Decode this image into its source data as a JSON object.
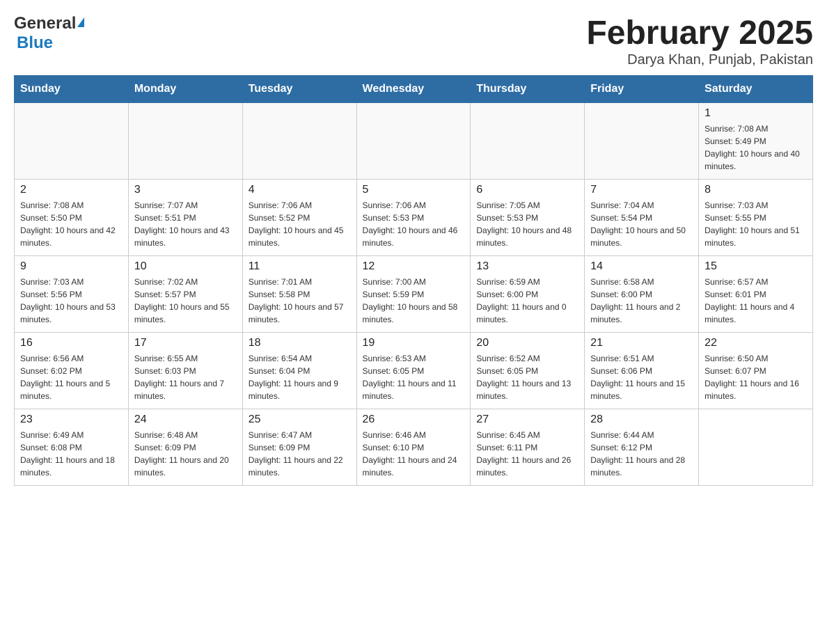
{
  "header": {
    "logo_general": "General",
    "logo_blue": "Blue",
    "title": "February 2025",
    "subtitle": "Darya Khan, Punjab, Pakistan"
  },
  "days_of_week": [
    "Sunday",
    "Monday",
    "Tuesday",
    "Wednesday",
    "Thursday",
    "Friday",
    "Saturday"
  ],
  "weeks": [
    {
      "days": [
        {
          "number": "",
          "sunrise": "",
          "sunset": "",
          "daylight": ""
        },
        {
          "number": "",
          "sunrise": "",
          "sunset": "",
          "daylight": ""
        },
        {
          "number": "",
          "sunrise": "",
          "sunset": "",
          "daylight": ""
        },
        {
          "number": "",
          "sunrise": "",
          "sunset": "",
          "daylight": ""
        },
        {
          "number": "",
          "sunrise": "",
          "sunset": "",
          "daylight": ""
        },
        {
          "number": "",
          "sunrise": "",
          "sunset": "",
          "daylight": ""
        },
        {
          "number": "1",
          "sunrise": "Sunrise: 7:08 AM",
          "sunset": "Sunset: 5:49 PM",
          "daylight": "Daylight: 10 hours and 40 minutes."
        }
      ]
    },
    {
      "days": [
        {
          "number": "2",
          "sunrise": "Sunrise: 7:08 AM",
          "sunset": "Sunset: 5:50 PM",
          "daylight": "Daylight: 10 hours and 42 minutes."
        },
        {
          "number": "3",
          "sunrise": "Sunrise: 7:07 AM",
          "sunset": "Sunset: 5:51 PM",
          "daylight": "Daylight: 10 hours and 43 minutes."
        },
        {
          "number": "4",
          "sunrise": "Sunrise: 7:06 AM",
          "sunset": "Sunset: 5:52 PM",
          "daylight": "Daylight: 10 hours and 45 minutes."
        },
        {
          "number": "5",
          "sunrise": "Sunrise: 7:06 AM",
          "sunset": "Sunset: 5:53 PM",
          "daylight": "Daylight: 10 hours and 46 minutes."
        },
        {
          "number": "6",
          "sunrise": "Sunrise: 7:05 AM",
          "sunset": "Sunset: 5:53 PM",
          "daylight": "Daylight: 10 hours and 48 minutes."
        },
        {
          "number": "7",
          "sunrise": "Sunrise: 7:04 AM",
          "sunset": "Sunset: 5:54 PM",
          "daylight": "Daylight: 10 hours and 50 minutes."
        },
        {
          "number": "8",
          "sunrise": "Sunrise: 7:03 AM",
          "sunset": "Sunset: 5:55 PM",
          "daylight": "Daylight: 10 hours and 51 minutes."
        }
      ]
    },
    {
      "days": [
        {
          "number": "9",
          "sunrise": "Sunrise: 7:03 AM",
          "sunset": "Sunset: 5:56 PM",
          "daylight": "Daylight: 10 hours and 53 minutes."
        },
        {
          "number": "10",
          "sunrise": "Sunrise: 7:02 AM",
          "sunset": "Sunset: 5:57 PM",
          "daylight": "Daylight: 10 hours and 55 minutes."
        },
        {
          "number": "11",
          "sunrise": "Sunrise: 7:01 AM",
          "sunset": "Sunset: 5:58 PM",
          "daylight": "Daylight: 10 hours and 57 minutes."
        },
        {
          "number": "12",
          "sunrise": "Sunrise: 7:00 AM",
          "sunset": "Sunset: 5:59 PM",
          "daylight": "Daylight: 10 hours and 58 minutes."
        },
        {
          "number": "13",
          "sunrise": "Sunrise: 6:59 AM",
          "sunset": "Sunset: 6:00 PM",
          "daylight": "Daylight: 11 hours and 0 minutes."
        },
        {
          "number": "14",
          "sunrise": "Sunrise: 6:58 AM",
          "sunset": "Sunset: 6:00 PM",
          "daylight": "Daylight: 11 hours and 2 minutes."
        },
        {
          "number": "15",
          "sunrise": "Sunrise: 6:57 AM",
          "sunset": "Sunset: 6:01 PM",
          "daylight": "Daylight: 11 hours and 4 minutes."
        }
      ]
    },
    {
      "days": [
        {
          "number": "16",
          "sunrise": "Sunrise: 6:56 AM",
          "sunset": "Sunset: 6:02 PM",
          "daylight": "Daylight: 11 hours and 5 minutes."
        },
        {
          "number": "17",
          "sunrise": "Sunrise: 6:55 AM",
          "sunset": "Sunset: 6:03 PM",
          "daylight": "Daylight: 11 hours and 7 minutes."
        },
        {
          "number": "18",
          "sunrise": "Sunrise: 6:54 AM",
          "sunset": "Sunset: 6:04 PM",
          "daylight": "Daylight: 11 hours and 9 minutes."
        },
        {
          "number": "19",
          "sunrise": "Sunrise: 6:53 AM",
          "sunset": "Sunset: 6:05 PM",
          "daylight": "Daylight: 11 hours and 11 minutes."
        },
        {
          "number": "20",
          "sunrise": "Sunrise: 6:52 AM",
          "sunset": "Sunset: 6:05 PM",
          "daylight": "Daylight: 11 hours and 13 minutes."
        },
        {
          "number": "21",
          "sunrise": "Sunrise: 6:51 AM",
          "sunset": "Sunset: 6:06 PM",
          "daylight": "Daylight: 11 hours and 15 minutes."
        },
        {
          "number": "22",
          "sunrise": "Sunrise: 6:50 AM",
          "sunset": "Sunset: 6:07 PM",
          "daylight": "Daylight: 11 hours and 16 minutes."
        }
      ]
    },
    {
      "days": [
        {
          "number": "23",
          "sunrise": "Sunrise: 6:49 AM",
          "sunset": "Sunset: 6:08 PM",
          "daylight": "Daylight: 11 hours and 18 minutes."
        },
        {
          "number": "24",
          "sunrise": "Sunrise: 6:48 AM",
          "sunset": "Sunset: 6:09 PM",
          "daylight": "Daylight: 11 hours and 20 minutes."
        },
        {
          "number": "25",
          "sunrise": "Sunrise: 6:47 AM",
          "sunset": "Sunset: 6:09 PM",
          "daylight": "Daylight: 11 hours and 22 minutes."
        },
        {
          "number": "26",
          "sunrise": "Sunrise: 6:46 AM",
          "sunset": "Sunset: 6:10 PM",
          "daylight": "Daylight: 11 hours and 24 minutes."
        },
        {
          "number": "27",
          "sunrise": "Sunrise: 6:45 AM",
          "sunset": "Sunset: 6:11 PM",
          "daylight": "Daylight: 11 hours and 26 minutes."
        },
        {
          "number": "28",
          "sunrise": "Sunrise: 6:44 AM",
          "sunset": "Sunset: 6:12 PM",
          "daylight": "Daylight: 11 hours and 28 minutes."
        },
        {
          "number": "",
          "sunrise": "",
          "sunset": "",
          "daylight": ""
        }
      ]
    }
  ]
}
